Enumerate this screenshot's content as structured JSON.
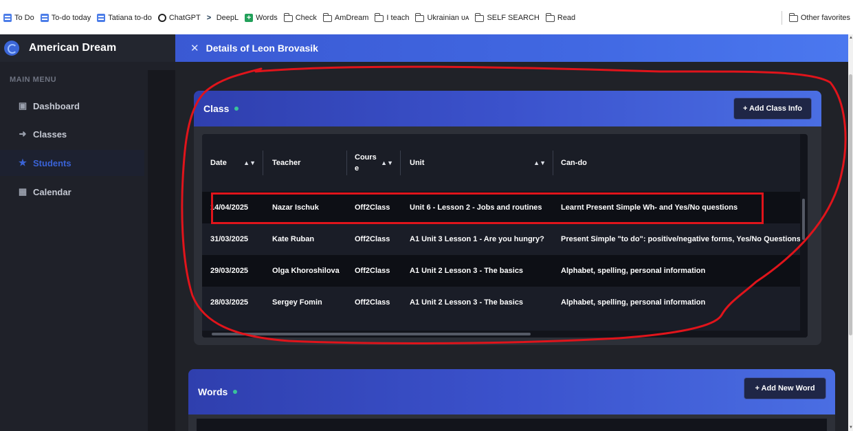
{
  "bookmarks": [
    {
      "label": "To Do",
      "icon": "todo-icon"
    },
    {
      "label": "To-do today",
      "icon": "todo-icon"
    },
    {
      "label": "Tatiana to-do",
      "icon": "todo-icon"
    },
    {
      "label": "ChatGPT",
      "icon": "chatgpt-icon"
    },
    {
      "label": "DeepL",
      "icon": "deepl-icon"
    },
    {
      "label": "Words",
      "icon": "words-icon"
    },
    {
      "label": "Check",
      "icon": "folder-icon"
    },
    {
      "label": "AmDream",
      "icon": "folder-icon"
    },
    {
      "label": "I teach",
      "icon": "folder-icon"
    },
    {
      "label": "Ukrainian ᴜᴀ",
      "icon": "folder-icon"
    },
    {
      "label": "SELF SEARCH",
      "icon": "folder-icon"
    },
    {
      "label": "Read",
      "icon": "folder-icon"
    }
  ],
  "other_favorites": "Other favorites",
  "app": {
    "name": "American Dream"
  },
  "sidebar": {
    "menu_title": "MAIN MENU",
    "items": [
      {
        "label": "Dashboard",
        "icon": "dashboard-icon",
        "active": false
      },
      {
        "label": "Classes",
        "icon": "classes-icon",
        "active": false
      },
      {
        "label": "Students",
        "icon": "students-icon",
        "active": true
      },
      {
        "label": "Calendar",
        "icon": "calendar-icon",
        "active": false
      }
    ]
  },
  "header": {
    "title": "Details of Leon Brovasik"
  },
  "class_card": {
    "title": "Class",
    "add_button": "+ Add Class Info",
    "columns": [
      "Date",
      "Teacher",
      "Cours e",
      "Unit",
      "Can-do"
    ],
    "rows": [
      {
        "date": "14/04/2025",
        "teacher": "Nazar Ischuk",
        "course": "Off2Class",
        "unit": "Unit 6 - Lesson 2 - Jobs and routines",
        "cando": "Learnt Present Simple Wh- and Yes/No questions"
      },
      {
        "date": "31/03/2025",
        "teacher": "Kate Ruban",
        "course": "Off2Class",
        "unit": "A1 Unit 3 Lesson 1 - Are you hungry?",
        "cando": "Present Simple \"to do\": positive/negative forms, Yes/No Questions"
      },
      {
        "date": "29/03/2025",
        "teacher": "Olga Khoroshilova",
        "course": "Off2Class",
        "unit": "A1 Unit 2 Lesson 3 - The basics",
        "cando": "Alphabet, spelling, personal information"
      },
      {
        "date": "28/03/2025",
        "teacher": "Sergey Fomin",
        "course": "Off2Class",
        "unit": "A1 Unit 2 Lesson 3 - The basics",
        "cando": "Alphabet, spelling, personal information"
      }
    ]
  },
  "words_card": {
    "title": "Words",
    "add_button": "+ Add New Word"
  },
  "colors": {
    "accent": "#3a63d6",
    "highlight": "#e0141b",
    "status_dot": "#39c39a"
  }
}
